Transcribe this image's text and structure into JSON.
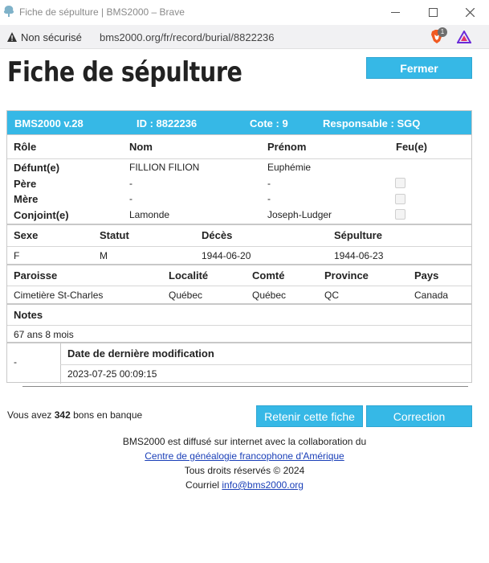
{
  "browser": {
    "window_title": "Fiche de sépulture | BMS2000 – Brave",
    "security_label": "Non sécurisé",
    "url": "bms2000.org/fr/record/burial/8822236",
    "brave_badge_count": "1"
  },
  "page": {
    "title": "Fiche de sépulture",
    "close_button": "Fermer"
  },
  "record": {
    "header": {
      "version": "BMS2000 v.28",
      "id": "ID : 8822236",
      "cote": "Cote : 9",
      "responsable": "Responsable : SGQ"
    },
    "people_columns": [
      "Rôle",
      "Nom",
      "Prénom",
      "Feu(e)"
    ],
    "people": [
      {
        "role": "Défunt(e)",
        "nom": "FILLION FILION",
        "prenom": "Euphémie",
        "feu": null
      },
      {
        "role": "Père",
        "nom": "-",
        "prenom": "-",
        "feu": false
      },
      {
        "role": "Mère",
        "nom": "-",
        "prenom": "-",
        "feu": false
      },
      {
        "role": "Conjoint(e)",
        "nom": "Lamonde",
        "prenom": "Joseph-Ludger",
        "feu": false
      }
    ],
    "vitals_columns": [
      "Sexe",
      "Statut",
      "Décès",
      "Sépulture"
    ],
    "vitals": [
      "F",
      "M",
      "1944-06-20",
      "1944-06-23"
    ],
    "place_columns": [
      "Paroisse",
      "Localité",
      "Comté",
      "Province",
      "Pays"
    ],
    "place": [
      "Cimetière St-Charles",
      "Québec",
      "Québec",
      "QC",
      "Canada"
    ],
    "notes_label": "Notes",
    "notes": "67 ans 8 mois",
    "modification": {
      "left_value": "-",
      "label": "Date de dernière modification",
      "value": "2023-07-25 00:09:15"
    }
  },
  "bank": {
    "prefix": "Vous avez",
    "count": "342",
    "suffix": "bons en banque"
  },
  "actions": {
    "retain": "Retenir cette fiche",
    "correction": "Correction"
  },
  "footer": {
    "line1": "BMS2000 est diffusé sur internet avec la collaboration du",
    "link1": "Centre de généalogie francophone d'Amérique",
    "line3": "Tous droits réservés © 2024",
    "line4_prefix": "Courriel",
    "email": "info@bms2000.org"
  },
  "colors": {
    "accent": "#36b8e6",
    "link": "#1a3fb8"
  }
}
